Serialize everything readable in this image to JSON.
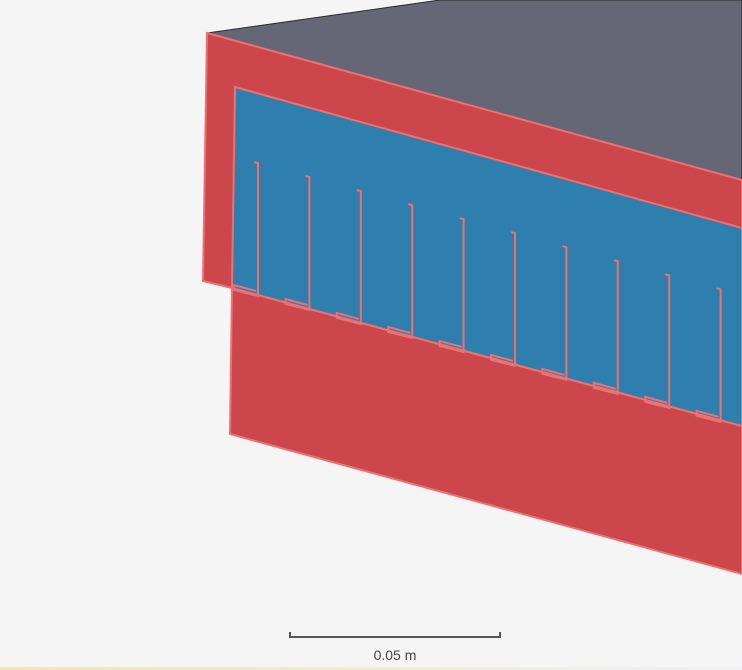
{
  "scale": {
    "label": "0.05 m"
  },
  "colors": {
    "background": "#f5f5f5",
    "top_face": "#656776",
    "housing": "#cc474b",
    "housing_edge": "#f07070",
    "interior": "#2f7fae",
    "fin": "#f07070"
  },
  "fins": {
    "count": 10
  }
}
